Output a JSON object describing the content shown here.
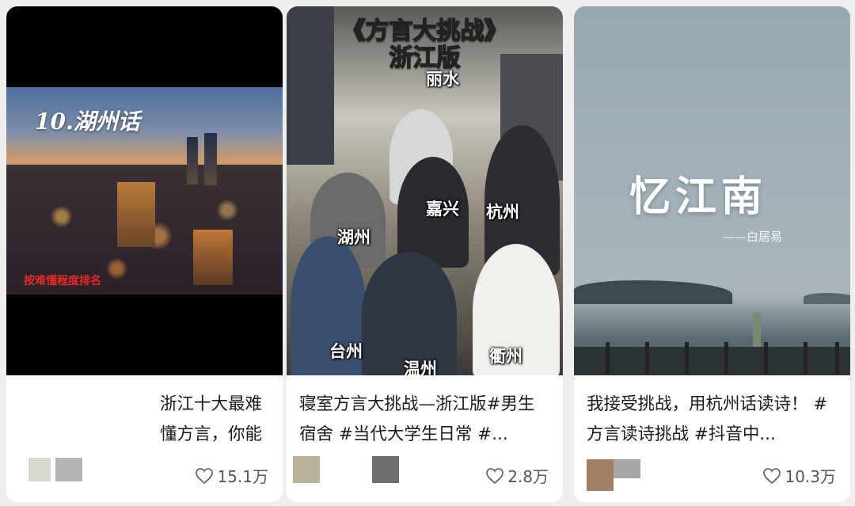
{
  "cards": [
    {
      "overlay_title": "10.湖州话",
      "overlay_subtitle": "按难懂程度排名",
      "caption": "浙江十大最难懂方言，你能听懂几个?...",
      "author": "…",
      "likes": "15.1万"
    },
    {
      "overlay_title_line1": "《方言大挑战》",
      "overlay_title_line2": "浙江版",
      "dialects": [
        "丽水",
        "湖州",
        "嘉兴",
        "杭州",
        "台州",
        "温州",
        "衢州"
      ],
      "caption": "寝室方言大挑战—浙江版#男生宿舍 #当代大学生日常 #...",
      "likes": "2.8万"
    },
    {
      "overlay_title": "忆江南",
      "overlay_subtitle": "——白居易",
      "caption": "我接受挑战，用杭州话读诗！ #方言读诗挑战 #抖音中...",
      "likes": "10.3万"
    }
  ],
  "colors": {
    "accent_yellow": "#ffe800",
    "accent_red": "#e52a2a"
  },
  "icons": {
    "like": "heart-outline-icon"
  }
}
